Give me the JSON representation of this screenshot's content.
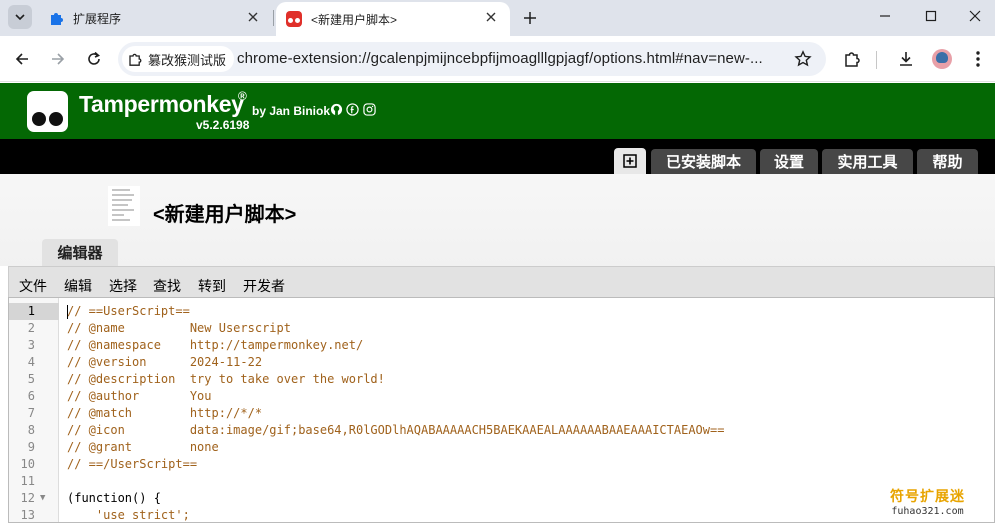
{
  "browser": {
    "tabs": [
      {
        "title": "扩展程序",
        "icon": "puzzle-icon"
      },
      {
        "title": "<新建用户脚本>",
        "icon": "tampermonkey-icon",
        "active": true
      }
    ],
    "site_chip": "篡改猴测试版",
    "url": "chrome-extension://gcalenpjmijncebpfijmoaglllgpjagf/options.html#nav=new-..."
  },
  "tampermonkey": {
    "name": "Tampermonkey",
    "registered": "®",
    "by": "by Jan Biniok",
    "version": "v5.2.6198",
    "nav": [
      "已安装脚本",
      "设置",
      "实用工具",
      "帮助"
    ],
    "script_title": "<新建用户脚本>",
    "editor_tab": "编辑器",
    "menu": [
      "文件",
      "编辑",
      "选择",
      "查找",
      "转到",
      "开发者"
    ]
  },
  "code": [
    {
      "n": "1",
      "text": "// ==UserScript=="
    },
    {
      "n": "2",
      "text": "// @name         New Userscript"
    },
    {
      "n": "3",
      "text": "// @namespace    http://tampermonkey.net/"
    },
    {
      "n": "4",
      "text": "// @version      2024-11-22"
    },
    {
      "n": "5",
      "text": "// @description  try to take over the world!"
    },
    {
      "n": "6",
      "text": "// @author       You"
    },
    {
      "n": "7",
      "text": "// @match        http://*/*"
    },
    {
      "n": "8",
      "text": "// @icon         data:image/gif;base64,R0lGODlhAQABAAAAACH5BAEKAAEALAAAAAABAAEAAAICTAEAOw=="
    },
    {
      "n": "9",
      "text": "// @grant        none"
    },
    {
      "n": "10",
      "text": "// ==/UserScript=="
    },
    {
      "n": "11",
      "text": ""
    },
    {
      "n": "12",
      "text": "(function() {"
    },
    {
      "n": "13",
      "text": "    'use strict';"
    }
  ],
  "watermark": {
    "cn": "符号扩展迷",
    "url": "fuhao321.com"
  },
  "colors": {
    "tm_green": "#046804",
    "comment": "#a0621c",
    "nav_bg": "#000000"
  }
}
